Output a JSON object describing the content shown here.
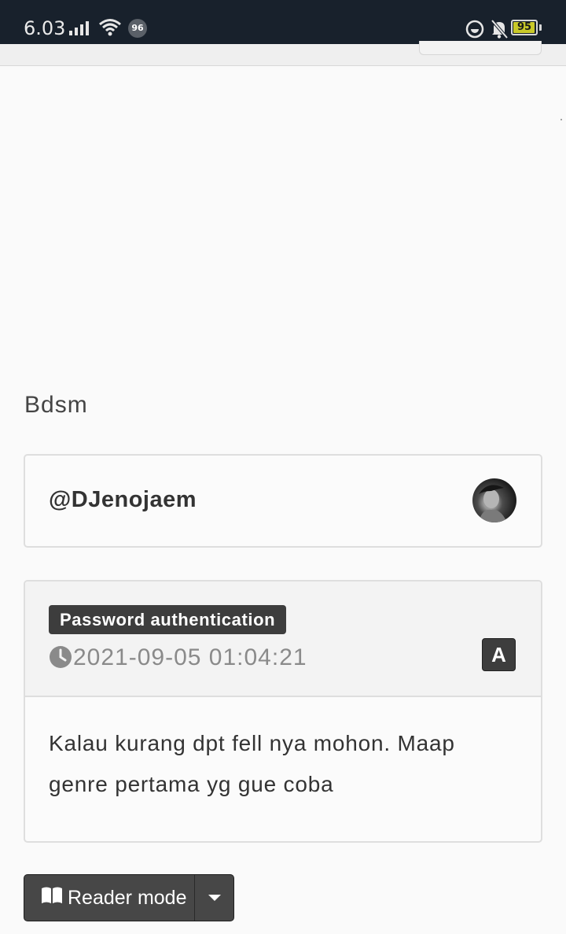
{
  "status_bar": {
    "time": "6.03",
    "notification_count": "96",
    "battery_percent": "95",
    "battery_level": 0.95,
    "icons": [
      "signal-icon",
      "wifi-icon",
      "do-not-disturb-icon",
      "bell-muted-icon",
      "battery-icon"
    ]
  },
  "story": {
    "title": "Bdsm"
  },
  "author": {
    "username": "@DJenojaem"
  },
  "post": {
    "auth_badge": "Password authentication",
    "timestamp": "2021-09-05 01:04:21",
    "font_button": "A",
    "body": "Kalau kurang dpt fell nya mohon. Maap genre pertama yg gue coba"
  },
  "toolbar": {
    "reader_mode_label": "Reader mode"
  },
  "colors": {
    "status_bar_bg": "#18212c",
    "badge_bg": "#3d3d3d",
    "page_bg": "#fafafa"
  }
}
